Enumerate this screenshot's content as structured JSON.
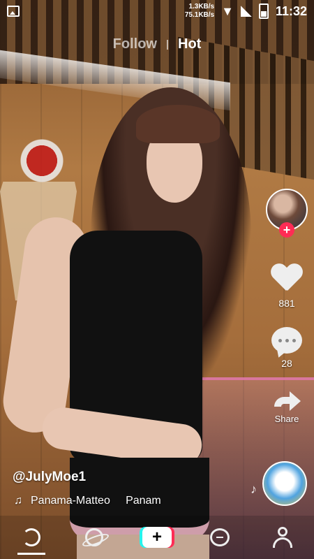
{
  "status_bar": {
    "net_up": "1.3KB/s",
    "net_down": "75.1KB/s",
    "time": "11:32"
  },
  "top_tabs": {
    "follow": "Follow",
    "hot": "Hot",
    "active": "Hot"
  },
  "right_rail": {
    "like_count": "881",
    "comment_count": "28",
    "share_label": "Share",
    "follow_plus": "+"
  },
  "video": {
    "username": "@JulyMoe1",
    "sound": "Panama-Matteo     Panam"
  },
  "bottom_nav": {
    "create_plus": "+",
    "items": [
      "home-icon",
      "discover-icon",
      "create-button",
      "inbox-icon",
      "profile-icon"
    ]
  },
  "colors": {
    "accent_red": "#fe2c55",
    "accent_cyan": "#25f4ee"
  }
}
